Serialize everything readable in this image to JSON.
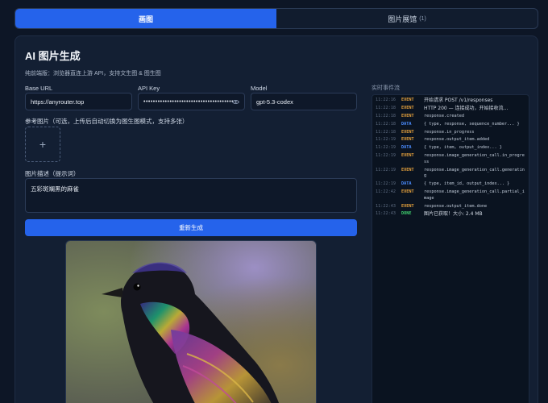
{
  "tabs": [
    {
      "label": "画图",
      "active": true
    },
    {
      "label": "图片展馆",
      "count": "(1)",
      "active": false
    }
  ],
  "main": {
    "title": "AI 图片生成",
    "subtitle": "纯前端版：浏览器直连上游 API，支持文生图 & 图生图",
    "base_url_label": "Base URL",
    "base_url_value": "https://anyrouter.top",
    "api_key_label": "API Key",
    "api_key_value": "••••••••••••••••••••••••••••••••••••••••••••••••••••••",
    "model_label": "Model",
    "model_value": "gpt-5.3-codex",
    "ref_label": "参考图片（可选，上传后自动切换为图生图模式，支持多张）",
    "upload_icon": "+",
    "prompt_label": "图片描述（提示词）",
    "prompt_value": "五彩斑斓黑的麻雀",
    "generate_label": "重新生成"
  },
  "events": {
    "title": "实时事件流",
    "rows": [
      {
        "time": "11:22:16",
        "tag": "EVENT",
        "msg": "开始请求 POST /v1/responses",
        "cn": true
      },
      {
        "time": "11:22:18",
        "tag": "EVENT",
        "msg": "HTTP 200 — 连接成功，开始接收流…",
        "cn": true
      },
      {
        "time": "11:22:18",
        "tag": "EVENT",
        "msg": "response.created"
      },
      {
        "time": "11:22:18",
        "tag": "DATA",
        "msg": "{ type, response, sequence_number... }"
      },
      {
        "time": "11:22:18",
        "tag": "EVENT",
        "msg": "response.in_progress"
      },
      {
        "time": "11:22:19",
        "tag": "EVENT",
        "msg": "response.output_item.added"
      },
      {
        "time": "11:22:19",
        "tag": "DATA",
        "msg": "{ type, item, output_index... }"
      },
      {
        "time": "11:22:19",
        "tag": "EVENT",
        "msg": "response.image_generation_call.in_progress"
      },
      {
        "time": "11:22:19",
        "tag": "EVENT",
        "msg": "response.image_generation_call.generating"
      },
      {
        "time": "11:22:19",
        "tag": "DATA",
        "msg": "{ type, item_id, output_index... }"
      },
      {
        "time": "11:22:42",
        "tag": "EVENT",
        "msg": "response.image_generation_call.partial_image"
      },
      {
        "time": "11:22:43",
        "tag": "EVENT",
        "msg": "response.output_item.done"
      },
      {
        "time": "11:22:43",
        "tag": "DONE",
        "msg": "图片已获取！大小: 2.4 MB",
        "cn": true
      }
    ]
  },
  "colors": {
    "accent": "#2563eb",
    "event_tag": "#e8a33d",
    "data_tag": "#4c8dff",
    "done_tag": "#3fcf6e"
  }
}
